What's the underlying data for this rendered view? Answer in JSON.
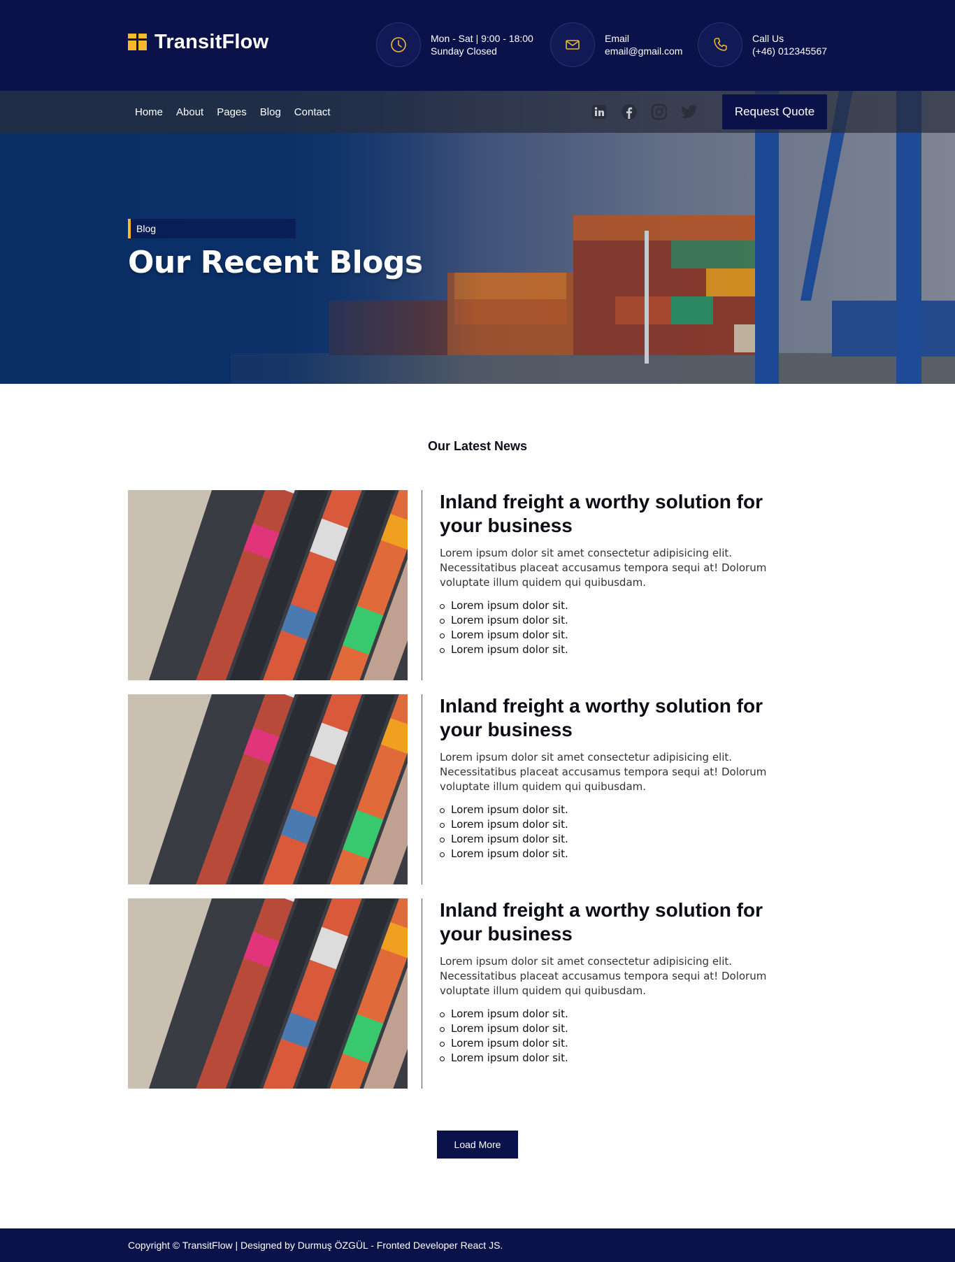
{
  "brand": {
    "name": "TransitFlow"
  },
  "header": {
    "hours": {
      "line1": "Mon - Sat | 9:00 - 18:00",
      "line2": "Sunday Closed"
    },
    "email": {
      "label": "Email",
      "value": "email@gmail.com"
    },
    "phone": {
      "label": "Call Us",
      "value": "(+46) 012345567"
    }
  },
  "nav": {
    "links": [
      "Home",
      "About",
      "Pages",
      "Blog",
      "Contact"
    ],
    "social": [
      "linkedin-icon",
      "facebook-icon",
      "instagram-icon",
      "twitter-icon"
    ],
    "cta": "Request Quote"
  },
  "hero": {
    "breadcrumb": "Blog",
    "title": "Our Recent Blogs"
  },
  "section": {
    "title": "Our Latest News"
  },
  "posts": [
    {
      "title": "Inland freight a worthy solution for your business",
      "text": "Lorem ipsum dolor sit amet consectetur adipisicing elit. Necessitatibus placeat accusamus tempora sequi at! Dolorum voluptate illum quidem qui quibusdam.",
      "bullets": [
        "Lorem ipsum dolor sit.",
        "Lorem ipsum dolor sit.",
        "Lorem ipsum dolor sit.",
        "Lorem ipsum dolor sit."
      ]
    },
    {
      "title": "Inland freight a worthy solution for your business",
      "text": "Lorem ipsum dolor sit amet consectetur adipisicing elit. Necessitatibus placeat accusamus tempora sequi at! Dolorum voluptate illum quidem qui quibusdam.",
      "bullets": [
        "Lorem ipsum dolor sit.",
        "Lorem ipsum dolor sit.",
        "Lorem ipsum dolor sit.",
        "Lorem ipsum dolor sit."
      ]
    },
    {
      "title": "Inland freight a worthy solution for your business",
      "text": "Lorem ipsum dolor sit amet consectetur adipisicing elit. Necessitatibus placeat accusamus tempora sequi at! Dolorum voluptate illum quidem qui quibusdam.",
      "bullets": [
        "Lorem ipsum dolor sit.",
        "Lorem ipsum dolor sit.",
        "Lorem ipsum dolor sit.",
        "Lorem ipsum dolor sit."
      ]
    }
  ],
  "load_more": "Load More",
  "footer": {
    "text": "Copyright © TransitFlow | Designed by Durmuş ÖZGÜL - Fronted Developer React JS."
  },
  "colors": {
    "navy": "#0b1149",
    "accent": "#f6b92c"
  }
}
